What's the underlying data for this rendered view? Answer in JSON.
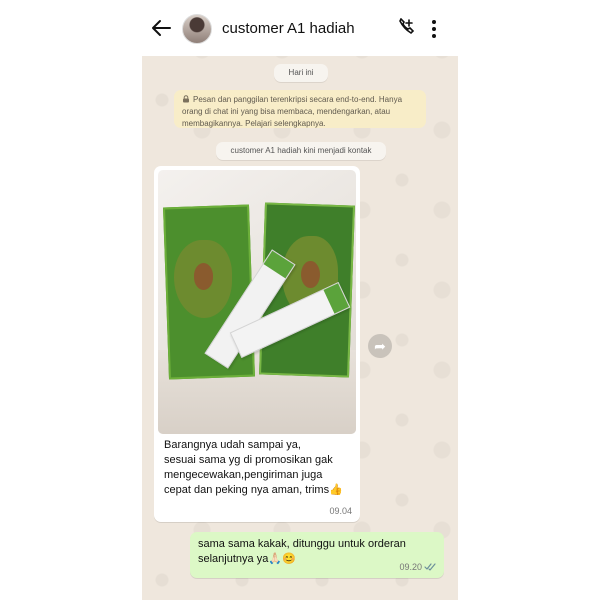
{
  "chat": {
    "contact_name": "customer A1 hadiah",
    "date_label": "Hari ini",
    "encryption_notice": "Pesan dan panggilan terenkripsi secara end-to-end. Hanya orang di chat ini yang bisa membaca, mendengarkan, atau membagikannya. Pelajari selengkapnya.",
    "contact_notice": "customer A1 hadiah kini menjadi kontak"
  },
  "messages": [
    {
      "type": "incoming-image",
      "text": "Barangnya udah sampai ya,\nsesuai sama yg di promosikan gak mengecewakan,pengiriman juga cepat dan peking nya aman, trims👍",
      "time": "09.04"
    },
    {
      "type": "outgoing",
      "text": "sama sama kakak, ditunggu untuk orderan selanjutnya ya🙏🏻😊",
      "time": "09.20"
    }
  ],
  "icons": [
    "back-arrow-icon",
    "add-call-icon",
    "more-options-icon",
    "lock-icon",
    "forward-icon",
    "read-ticks-icon"
  ],
  "colors": {
    "chat_background": "#efe7dd",
    "incoming_bubble": "#ffffff",
    "outgoing_bubble": "#dcf8c6",
    "encryption_bg": "#f8edc8"
  }
}
